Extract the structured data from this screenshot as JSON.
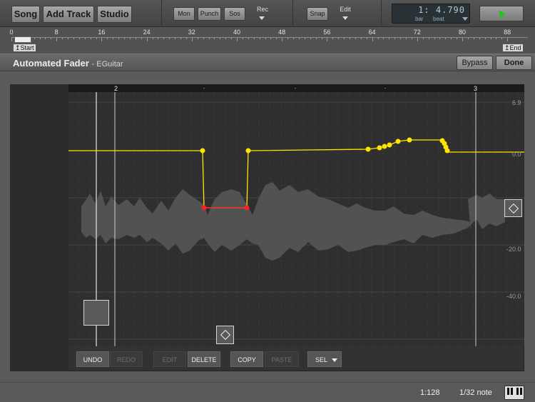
{
  "toolbar": {
    "song_label": "Song",
    "add_track_label": "Add Track",
    "studio_label": "Studio",
    "mon_label": "Mon",
    "punch_label": "Punch",
    "sos_label": "Sos",
    "rec_label": "Rec",
    "snap_label": "Snap",
    "edit_label": "Edit",
    "position_display": "1: 4.790",
    "bar_label": "bar",
    "beat_label": "beat",
    "play_icon": "play-icon",
    "play_color": "#21c321"
  },
  "ruler": {
    "numbers": [
      "0",
      "8",
      "16",
      "24",
      "32",
      "40",
      "48",
      "56",
      "64",
      "72",
      "80",
      "88"
    ],
    "start_marker": "Start",
    "end_marker": "End"
  },
  "panel": {
    "title": "Automated Fader",
    "subtitle": "- EGuitar",
    "bypass_label": "Bypass",
    "done_label": "Done"
  },
  "editor": {
    "bar_numbers": [
      "2",
      "3"
    ],
    "db_labels": [
      "6.9",
      "0.0",
      "-20.0",
      "-40.0"
    ],
    "automation_color": "#ffe400",
    "selected_color": "#ff2020"
  },
  "bottom_buttons": {
    "undo": "UNDO",
    "redo": "REDO",
    "edit": "EDIT",
    "delete": "DELETE",
    "copy": "COPY",
    "paste": "PASTE",
    "sel": "SEL"
  },
  "status": {
    "zoom": "1:128",
    "grid": "1/32 note",
    "keyboard_icon": "keyboard-icon"
  }
}
